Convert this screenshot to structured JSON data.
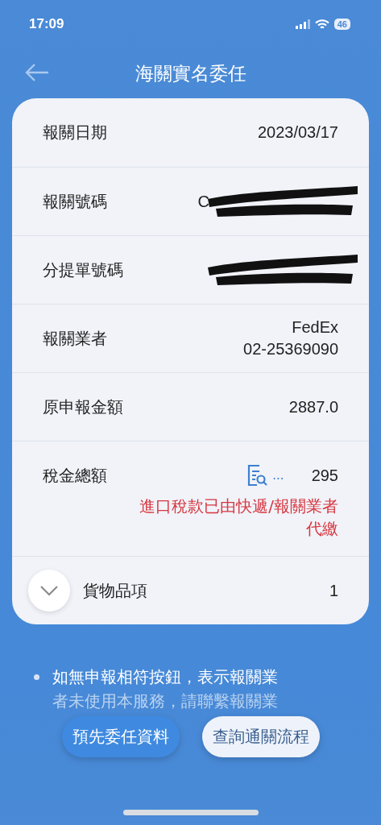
{
  "status_bar": {
    "time": "17:09",
    "battery": "46"
  },
  "header": {
    "title": "海關實名委任"
  },
  "rows": [
    {
      "kind": "plain",
      "label": "報關日期",
      "values": [
        "2023/03/17"
      ]
    },
    {
      "kind": "redacted",
      "label": "報關號碼",
      "values": [
        "C"
      ]
    },
    {
      "kind": "redacted",
      "label": "分提單號碼",
      "values": []
    },
    {
      "kind": "plain",
      "label": "報關業者",
      "values": [
        "FedEx",
        "02-25369090"
      ]
    },
    {
      "kind": "plain",
      "label": "原申報金額",
      "values": [
        "2887.0"
      ]
    },
    {
      "kind": "tax",
      "label": "稅金總額",
      "values": [
        "295"
      ],
      "more": "...",
      "note": "進口稅款已由快遞/報關業者代繳"
    },
    {
      "kind": "expand",
      "label": "貨物品項",
      "values": [
        "1"
      ],
      "expanded": false
    }
  ],
  "notes": [
    {
      "text": "如無申報相符按鈕，表示報關業",
      "faded": false
    },
    {
      "text": "者未使用本服務，請聯繫報關業",
      "faded": true
    }
  ],
  "buttons": [
    {
      "label": "預先委任資料",
      "primary": true
    },
    {
      "label": "查詢通關流程",
      "primary": false
    }
  ]
}
